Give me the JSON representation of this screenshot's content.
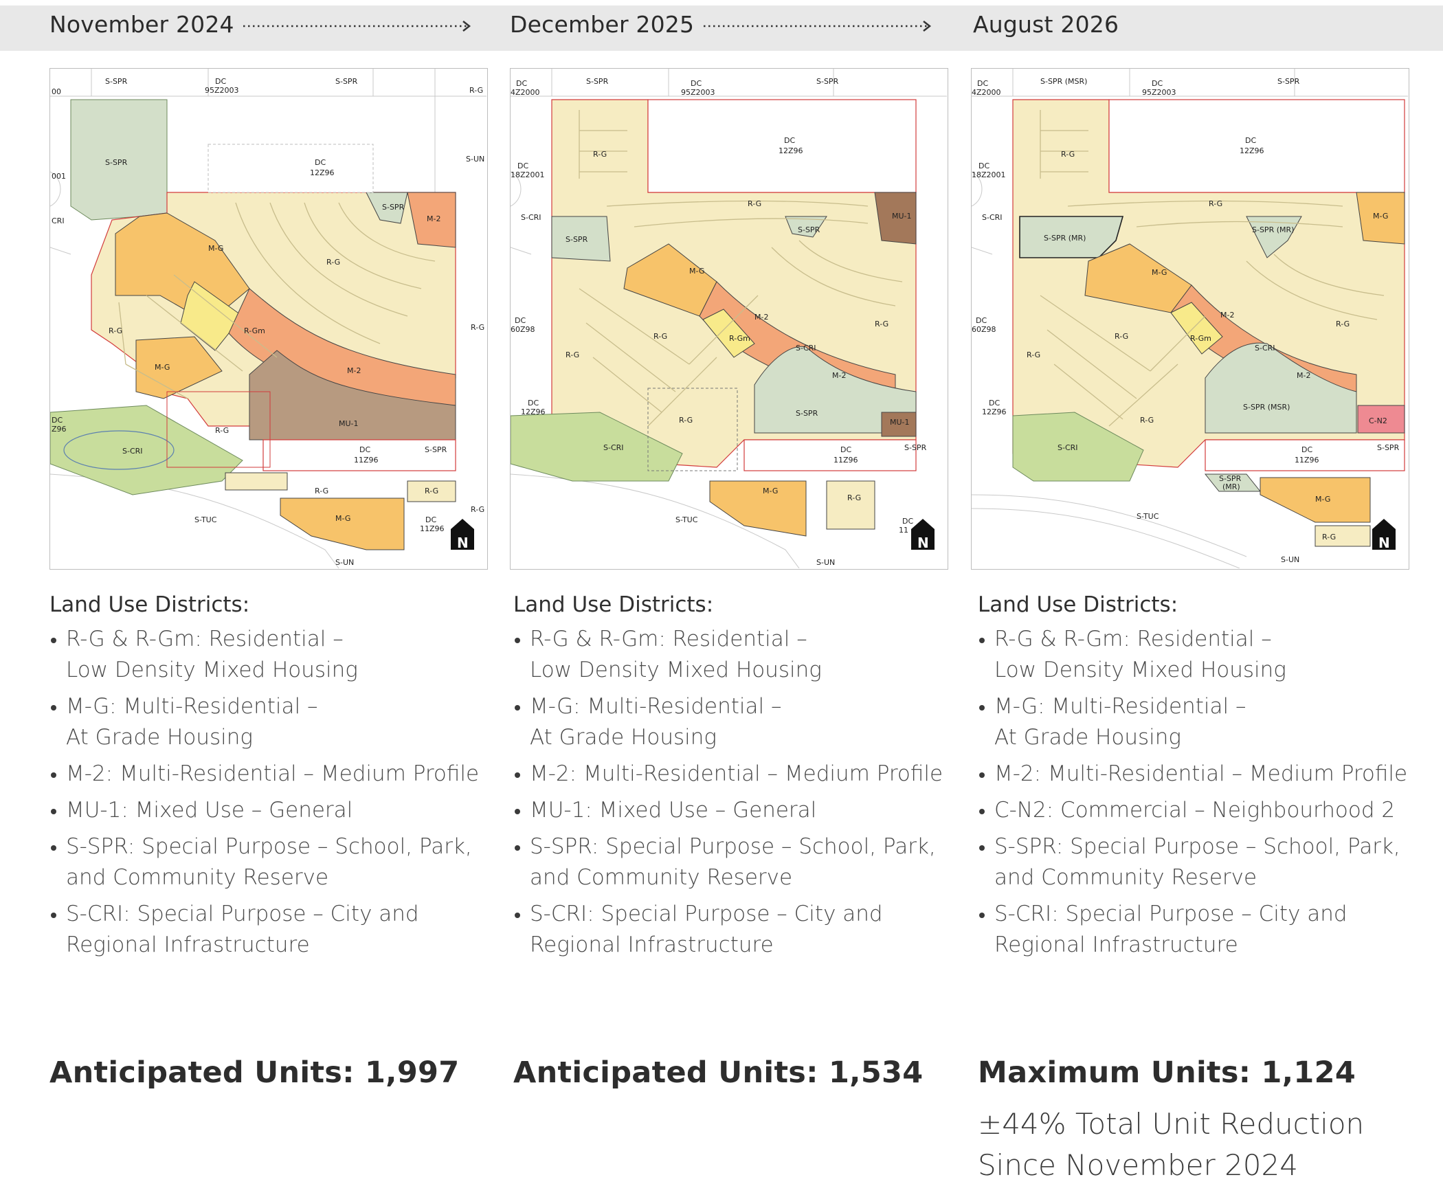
{
  "header": {
    "phase1": "November 2024",
    "phase2": "December 2025",
    "phase3": "August 2026"
  },
  "colors": {
    "residential": "#f6ecc2",
    "multi_grade": "#f7c36a",
    "medium_profile": "#f3a678",
    "mixed_use": "#b79a80",
    "mixed_use_dark": "#a3785a",
    "school_park": "#d3dfc9",
    "infrastructure": "#c8dd9c",
    "commercial": "#ee8a92",
    "rgm": "#f8ea8a",
    "boundary": "#d23b3b"
  },
  "maps": [
    {
      "name": "November 2024",
      "labels": {
        "sspr_top": "S-SPR",
        "dc_top": "DC",
        "dc_top_code": "95Z2003",
        "sspr_top2": "S-SPR",
        "rg_right_top": "R-G",
        "zero_zero": "00",
        "sspr_left": "S-SPR",
        "s_un_right": "S-UN",
        "dc_mid": "DC",
        "dc_mid_code": "12Z96",
        "code_001": "001",
        "cri_left": "CRI",
        "sspr_small": "S-SPR",
        "m2_corner": "M-2",
        "mg1": "M-G",
        "rg_curve": "R-G",
        "rg_west": "R-G",
        "rgm": "R-Gm",
        "rg_east": "R-G",
        "mg2": "M-G",
        "m2_band": "M-2",
        "dc_left": "DC",
        "dc_left_code": "Z96",
        "mu1": "MU-1",
        "rg_south": "R-G",
        "scri": "S-CRI",
        "dc_bottom": "DC",
        "dc_bottom_code": "11Z96",
        "sspr_bottom": "S-SPR",
        "rg_b1": "R-G",
        "rg_b2": "R-G",
        "rg_b3": "R-G",
        "stuc": "S-TUC",
        "mg_bottom": "M-G",
        "dc_corner": "DC",
        "dc_corner_code": "11Z96",
        "s_un_bottom": "S-UN",
        "north": "N"
      }
    },
    {
      "name": "December 2025",
      "labels": {
        "dc_tl": "DC",
        "dc_tl_code": "4Z2000",
        "sspr_top": "S-SPR",
        "dc_top": "DC",
        "dc_top_code": "95Z2003",
        "sspr_top2": "S-SPR",
        "rg_nw": "R-G",
        "dc_big": "DC",
        "dc_big_code": "12Z96",
        "dc_w": "DC",
        "dc_w_code": "18Z2001",
        "rg_band": "R-G",
        "scri_w": "S-CRI",
        "mu1_ne": "MU-1",
        "sspr_w": "S-SPR",
        "sspr_c": "S-SPR",
        "mg": "M-G",
        "dc_w2": "DC",
        "dc_w2_code": "60Z98",
        "m2": "M-2",
        "rg_e": "R-G",
        "rg_w": "R-G",
        "rg_c": "R-G",
        "rgm": "R-Gm",
        "scri_c": "S-CRI",
        "m2_b": "M-2",
        "dc_sw": "DC",
        "dc_sw_code": "12Z96",
        "rg_s": "R-G",
        "sspr_s": "S-SPR",
        "mu1_s": "MU-1",
        "scri_sw": "S-CRI",
        "dc_b": "DC",
        "dc_b_code": "11Z96",
        "sspr_b": "S-SPR",
        "mg_b": "M-G",
        "rg_b": "R-G",
        "stuc": "S-TUC",
        "dc_corner": "DC",
        "dc_corner_code": "11",
        "s_un": "S-UN",
        "north": "N"
      }
    },
    {
      "name": "August 2026",
      "labels": {
        "dc_tl": "DC",
        "dc_tl_code": "4Z2000",
        "sspr_top": "S-SPR (MSR)",
        "dc_top": "DC",
        "dc_top_code": "95Z2003",
        "sspr_top2": "S-SPR",
        "rg_nw": "R-G",
        "dc_big": "DC",
        "dc_big_code": "12Z96",
        "dc_w": "DC",
        "dc_w_code": "18Z2001",
        "rg_band": "R-G",
        "mg_ne": "M-G",
        "scri_w": "S-CRI",
        "sspr_w": "S-SPR (MR)",
        "sspr_c": "S-SPR (MR)",
        "mg": "M-G",
        "dc_w2": "DC",
        "dc_w2_code": "60Z98",
        "m2": "M-2",
        "rg_e": "R-G",
        "rg_w": "R-G",
        "rg_c": "R-G",
        "rgm": "R-Gm",
        "scri_c": "S-CRI",
        "m2_b": "M-2",
        "dc_sw": "DC",
        "dc_sw_code": "12Z96",
        "rg_s": "R-G",
        "sspr_s": "S-SPR (MSR)",
        "cn2": "C-N2",
        "scri_sw": "S-CRI",
        "dc_b": "DC",
        "dc_b_code": "11Z96",
        "sspr_b": "S-SPR",
        "sspr_small": "S-SPR",
        "sspr_small2": "(MR)",
        "mg_b": "M-G",
        "rg_b": "R-G",
        "stuc": "S-TUC",
        "s_un": "S-UN",
        "north": "N"
      }
    }
  ],
  "legend": [
    {
      "title": "Land Use Districts:",
      "items": [
        [
          "R-G & R-Gm: Residential –",
          "Low Density Mixed Housing"
        ],
        [
          "M-G: Multi-Residential –",
          "At Grade Housing"
        ],
        [
          "M-2: Multi-Residential – Medium Profile"
        ],
        [
          "MU-1: Mixed Use – General"
        ],
        [
          "S-SPR: Special Purpose – School, Park,",
          "and Community Reserve"
        ],
        [
          "S-CRI: Special Purpose – City and",
          "Regional Infrastructure"
        ]
      ]
    },
    {
      "title": "Land Use Districts:",
      "items": [
        [
          "R-G & R-Gm: Residential –",
          "Low Density Mixed Housing"
        ],
        [
          "M-G: Multi-Residential –",
          "At Grade Housing"
        ],
        [
          "M-2: Multi-Residential – Medium Profile"
        ],
        [
          "MU-1: Mixed Use – General"
        ],
        [
          "S-SPR: Special Purpose – School, Park,",
          "and Community Reserve"
        ],
        [
          "S-CRI: Special Purpose – City and",
          "Regional Infrastructure"
        ]
      ]
    },
    {
      "title": "Land Use Districts:",
      "items": [
        [
          "R-G & R-Gm: Residential –",
          "Low Density Mixed Housing"
        ],
        [
          "M-G: Multi-Residential –",
          "At Grade Housing"
        ],
        [
          "M-2: Multi-Residential – Medium Profile"
        ],
        [
          "C-N2: Commercial – Neighbourhood 2"
        ],
        [
          "S-SPR: Special Purpose – School, Park,",
          "and Community Reserve"
        ],
        [
          "S-CRI: Special Purpose – City and",
          "Regional Infrastructure"
        ]
      ]
    }
  ],
  "units": {
    "col1": "Anticipated Units: 1,997",
    "col2": "Anticipated Units: 1,534",
    "col3": "Maximum Units: 1,124"
  },
  "reduction": {
    "line1": "±44% Total Unit Reduction",
    "line2": "Since November 2024"
  }
}
